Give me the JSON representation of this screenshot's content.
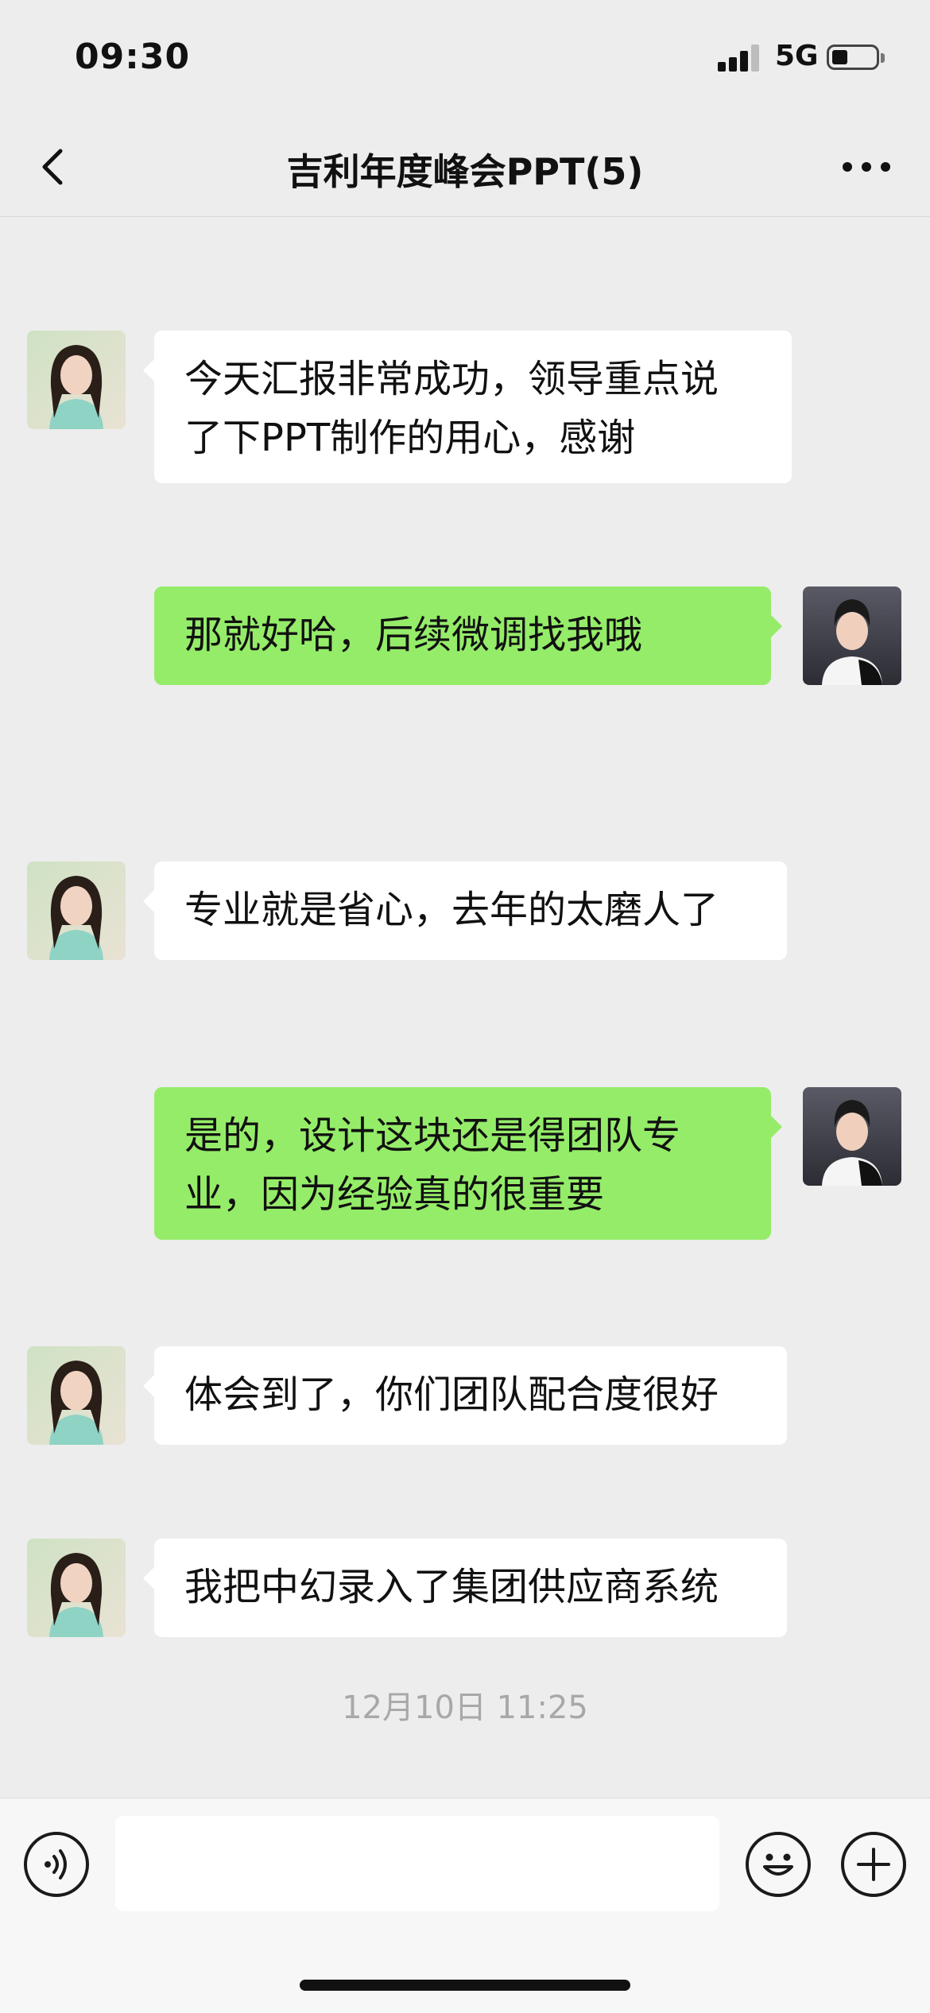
{
  "status_bar": {
    "time": "09:30",
    "network": "5G",
    "battery_level": 0.35
  },
  "header": {
    "title": "吉利年度峰会PPT(5)"
  },
  "messages": [
    {
      "side": "left",
      "text_lines": [
        "今天汇报非常成功，领导重点说",
        "了下PPT制作的用心，感谢"
      ]
    },
    {
      "side": "right",
      "text_lines": [
        "那就好哈，后续微调找我哦"
      ]
    },
    {
      "side": "left",
      "text_lines": [
        "专业就是省心，去年的太磨人了"
      ]
    },
    {
      "side": "right",
      "text_lines": [
        "是的，设计这块还是得团队专",
        "业，因为经验真的很重要"
      ]
    },
    {
      "side": "left",
      "text_lines": [
        "体会到了，你们团队配合度很好"
      ]
    },
    {
      "side": "left",
      "text_lines": [
        "我把中幻录入了集团供应商系统"
      ]
    }
  ],
  "timestamp": "12月10日 11:25",
  "input": {
    "value": "",
    "placeholder": ""
  },
  "icons": {
    "back": "chevron-left-icon",
    "more": "more-dots-icon",
    "voice": "voice-icon",
    "emoji": "emoji-icon",
    "add": "plus-icon"
  },
  "colors": {
    "sent_bubble": "#95ec69",
    "received_bubble": "#ffffff",
    "background": "#ededed"
  }
}
